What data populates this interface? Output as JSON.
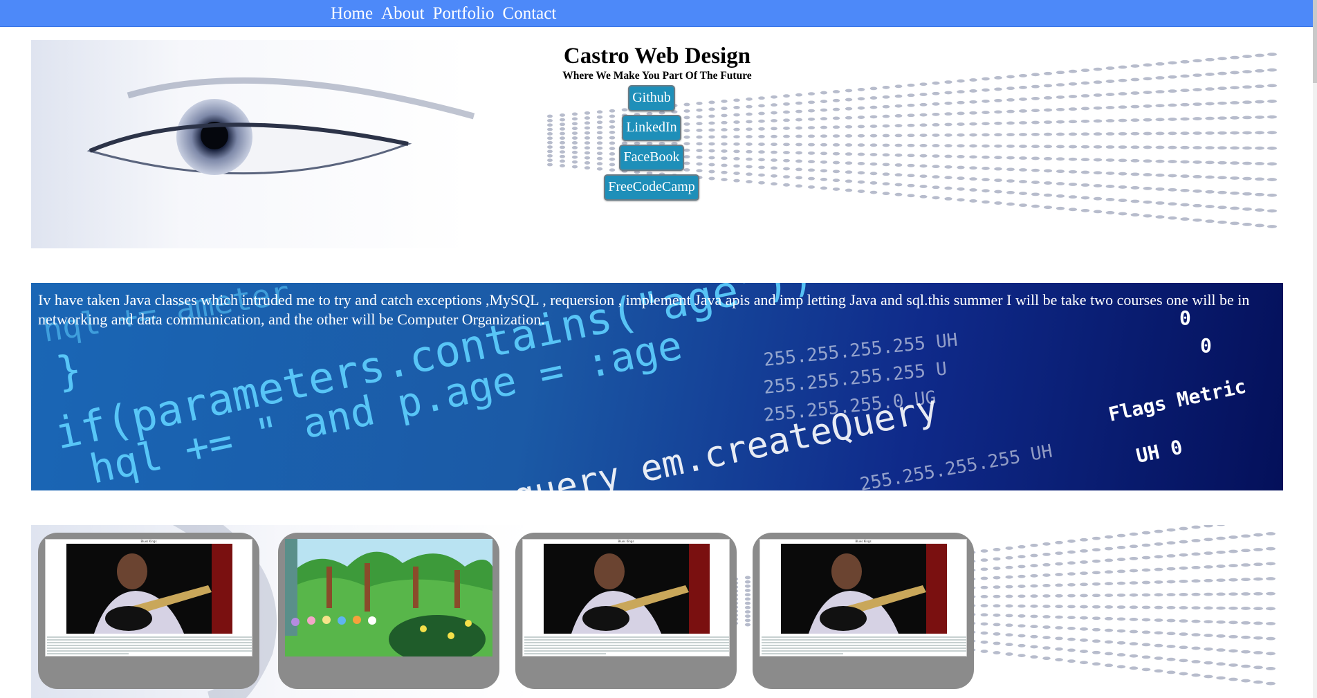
{
  "nav": {
    "items": [
      {
        "label": "Home"
      },
      {
        "label": "About"
      },
      {
        "label": "Portfolio"
      },
      {
        "label": "Contact"
      }
    ]
  },
  "hero": {
    "title": "Castro Web Design",
    "tagline": "Where We Make You Part Of The Future",
    "social_links": [
      {
        "label": "Github"
      },
      {
        "label": "LinkedIn"
      },
      {
        "label": "FaceBook"
      },
      {
        "label": "FreeCodeCamp"
      }
    ]
  },
  "about": {
    "text": "Iv have taken Java classes which intruded me to try and catch exceptions ,MySQL , requersion , implement Java apis and imp letting Java and sql.this summer I will be take two courses one will be in networking and data communication, and the other will be Computer Organization."
  },
  "portfolio": {
    "cards": [
      {
        "kind": "guitarist-screenshot"
      },
      {
        "kind": "pony-forest-scene"
      },
      {
        "kind": "guitarist-screenshot"
      },
      {
        "kind": "guitarist-screenshot"
      }
    ]
  },
  "colors": {
    "navbar": "#4d89f9",
    "social_button": "#1e8fb9",
    "card": "#8b8b8b",
    "banner_dark": "#04105a"
  }
}
